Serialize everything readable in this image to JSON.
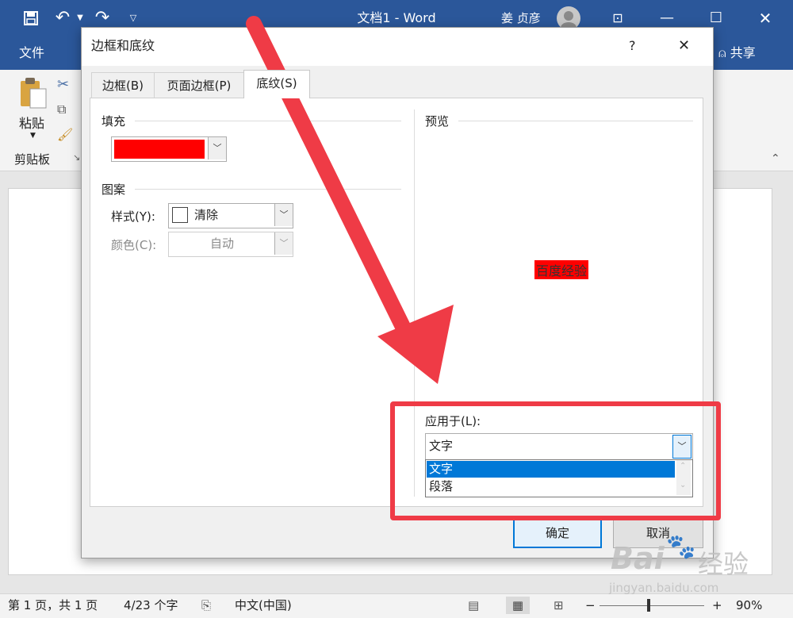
{
  "window": {
    "title": "文档1  -  Word",
    "user": "姜 贞彦",
    "share": "共享",
    "file_tab": "文件"
  },
  "ribbon": {
    "paste_label": "粘贴",
    "clipboard_group": "剪贴板"
  },
  "dialog": {
    "title": "边框和底纹",
    "help": "?",
    "close": "✕",
    "tabs": [
      {
        "label": "边框(B)"
      },
      {
        "label": "页面边框(P)"
      },
      {
        "label": "底纹(S)"
      }
    ],
    "fill": {
      "label": "填充",
      "color": "#ff0000"
    },
    "pattern": {
      "label": "图案",
      "style_label": "样式(Y):",
      "style_value": "清除",
      "color_label": "颜色(C):",
      "color_value": "自动"
    },
    "preview": {
      "label": "预览",
      "sample_text": "百度经验",
      "sample_bg": "#ff0000"
    },
    "apply_to": {
      "label": "应用于(L):",
      "selected": "文字",
      "options": [
        "文字",
        "段落"
      ]
    },
    "ok": "确定",
    "cancel": "取消"
  },
  "statusbar": {
    "page": "第 1 页，共 1 页",
    "words": "4/23 个字",
    "language": "中文(中国)",
    "zoom": "90%"
  },
  "watermark": {
    "brand": "Bai",
    "brand2": "经验",
    "url": "jingyan.baidu.com"
  },
  "colors": {
    "word_blue": "#2b579a",
    "annotation_red": "#ef3b46",
    "selection_blue": "#0078d7"
  }
}
